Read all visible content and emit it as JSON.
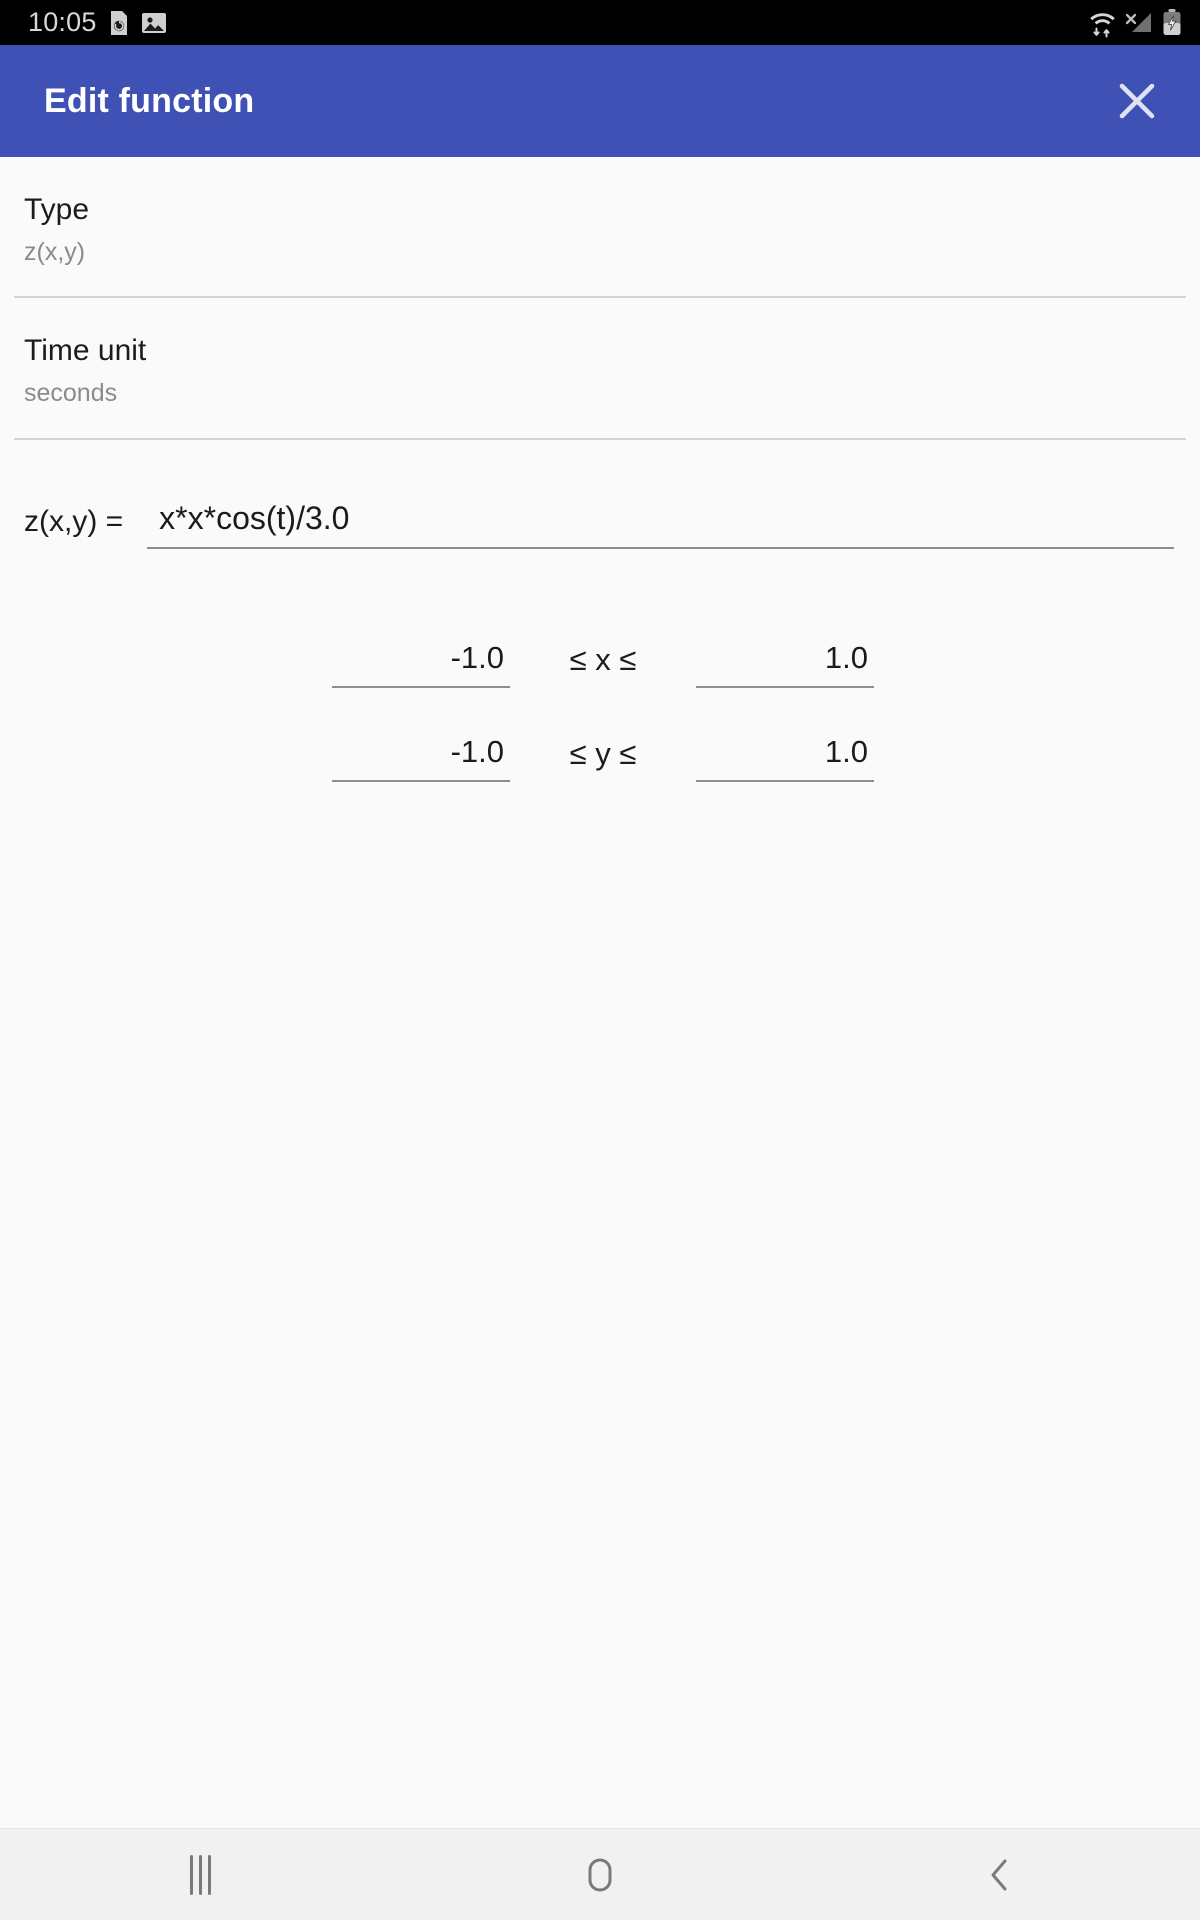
{
  "status_bar": {
    "clock": "10:05",
    "left_icons": [
      "sync-document-icon",
      "gallery-image-icon"
    ],
    "right_icons": [
      "wifi-transfer-icon",
      "no-signal-icon",
      "battery-charging-icon"
    ],
    "background_color": "#000000",
    "text_color": "#d8d8d8"
  },
  "toolbar": {
    "title": "Edit function",
    "close_label": "close-icon",
    "background_color": "#3f51b5",
    "text_color": "#ffffff"
  },
  "preferences": [
    {
      "title": "Type",
      "summary": "z(x,y)"
    },
    {
      "title": "Time unit",
      "summary": "seconds"
    }
  ],
  "formula": {
    "label": "z(x,y) =",
    "value": "x*x*cos(t)/3.0",
    "placeholder": "z(x,y)"
  },
  "ranges": [
    {
      "min": "-1.0",
      "operator": "≤ x ≤",
      "max": "1.0",
      "variable": "x"
    },
    {
      "min": "-1.0",
      "operator": "≤ y ≤",
      "max": "1.0",
      "variable": "y"
    }
  ],
  "nav_bar": {
    "recents_label": "recents-icon",
    "home_label": "home-icon",
    "back_label": "back-icon",
    "background_color": "#f1f1f1"
  }
}
